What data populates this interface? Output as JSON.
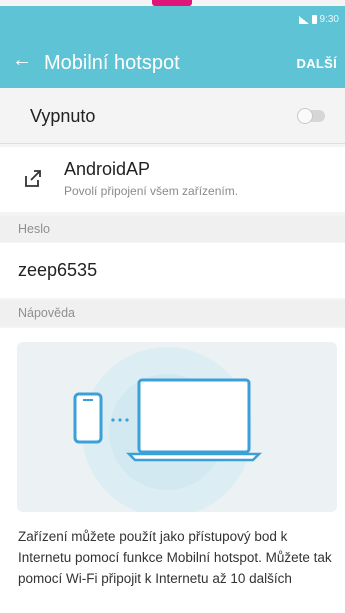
{
  "status": {
    "time": "9:30"
  },
  "appbar": {
    "title": "Mobilní hotspot",
    "action": "DALŠÍ"
  },
  "hotspot": {
    "state_label": "Vypnuto",
    "enabled": false
  },
  "access_point": {
    "name": "AndroidAP",
    "subtitle": "Povolí připojení všem zařízením."
  },
  "password": {
    "section_title": "Heslo",
    "value": "zeep6535"
  },
  "help": {
    "section_title": "Nápověda",
    "text": "Zařízení můžete použít jako přístupový bod k Internetu pomocí funkce Mobilní hotspot. Můžete tak pomocí Wi-Fi připojit k Internetu až 10 dalších"
  },
  "colors": {
    "accent": "#5ec3d4",
    "brand_mark": "#e0157a"
  }
}
